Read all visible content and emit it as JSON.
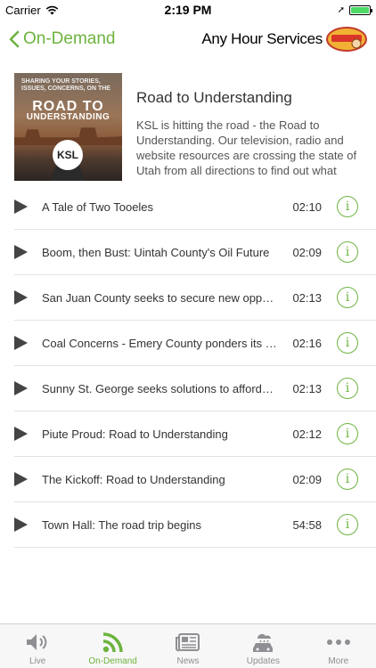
{
  "status_bar": {
    "carrier": "Carrier",
    "time": "2:19 PM"
  },
  "nav": {
    "back_label": "On-Demand",
    "sponsor": "Any Hour Services"
  },
  "program": {
    "cover_small_text": "Sharing your stories, issues, concerns, on the",
    "cover_title_line1": "ROAD TO",
    "cover_title_line2": "UNDERSTANDING",
    "cover_logo": "KSL",
    "title": "Road to Understanding",
    "description": "KSL is hitting the road - the Road to Understanding. Our television, radio and website resources are crossing the state of Utah from all directions to find out what issues matter to you, what you're proud of..."
  },
  "episodes": [
    {
      "title": "A Tale of Two Tooeles",
      "duration": "02:10"
    },
    {
      "title": "Boom, then Bust: Uintah County's Oil Future",
      "duration": "02:09"
    },
    {
      "title": "San Juan County seeks to secure new opportunities",
      "duration": "02:13"
    },
    {
      "title": "Coal Concerns - Emery County ponders its future",
      "duration": "02:16"
    },
    {
      "title": "Sunny St. George seeks solutions to affordable housing",
      "duration": "02:13"
    },
    {
      "title": "Piute Proud: Road to Understanding",
      "duration": "02:12"
    },
    {
      "title": "The Kickoff: Road to Understanding",
      "duration": "02:09"
    },
    {
      "title": "Town Hall: The road trip begins",
      "duration": "54:58"
    }
  ],
  "tabs": [
    {
      "label": "Live",
      "icon": "speaker-icon"
    },
    {
      "label": "On-Demand",
      "icon": "podcast-icon",
      "active": true
    },
    {
      "label": "News",
      "icon": "newspaper-icon"
    },
    {
      "label": "Updates",
      "icon": "traffic-weather-icon"
    },
    {
      "label": "More",
      "icon": "more-dots-icon"
    }
  ],
  "colors": {
    "accent": "#6db33f",
    "tab_inactive": "#8e8e93"
  }
}
